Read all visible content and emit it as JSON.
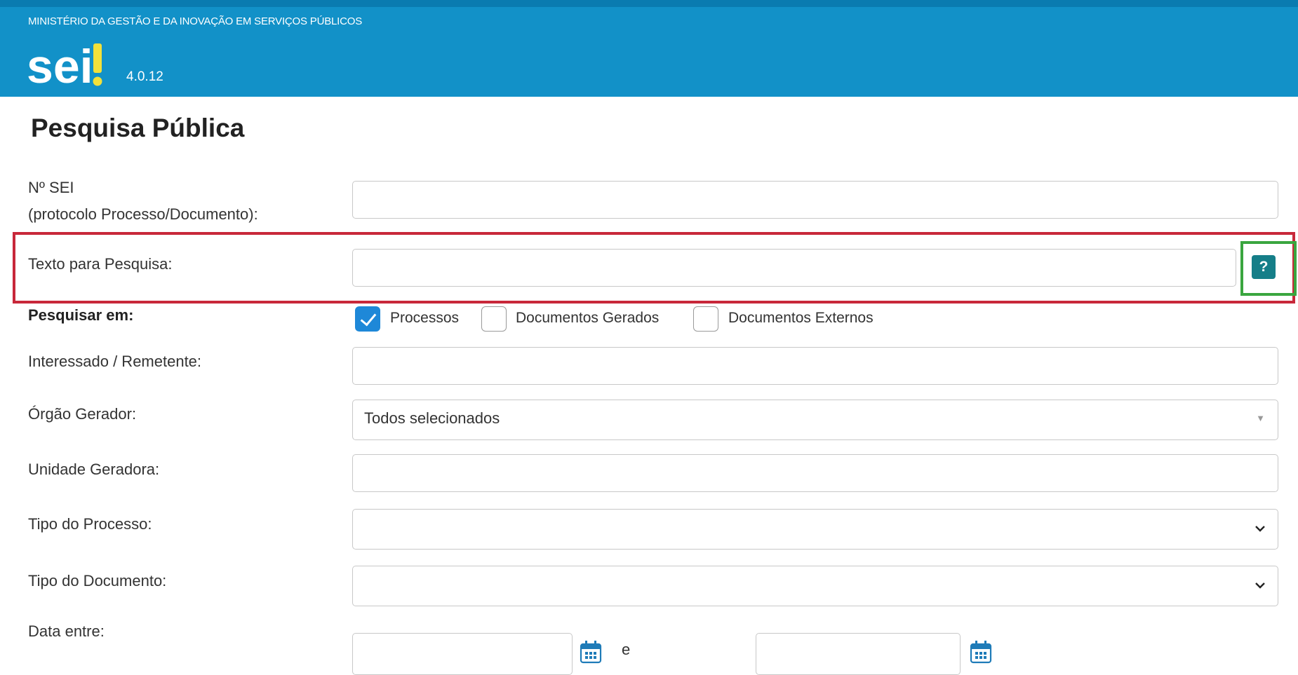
{
  "header": {
    "ministry": "MINISTÉRIO DA GESTÃO E DA INOVAÇÃO EM SERVIÇOS PÚBLICOS",
    "logo_text": "sei!",
    "version": "4.0.12"
  },
  "page_title": "Pesquisa Pública",
  "form": {
    "sei_number": {
      "label_line1": "Nº SEI",
      "label_line2": "(protocolo Processo/Documento):",
      "value": ""
    },
    "search_text": {
      "label": "Texto para Pesquisa:",
      "value": "",
      "help_label": "?"
    },
    "search_in": {
      "label": "Pesquisar em:",
      "options": [
        {
          "label": "Processos",
          "checked": true
        },
        {
          "label": "Documentos Gerados",
          "checked": false
        },
        {
          "label": "Documentos Externos",
          "checked": false
        }
      ]
    },
    "interested": {
      "label": "Interessado / Remetente:",
      "value": ""
    },
    "org": {
      "label": "Órgão Gerador:",
      "value": "Todos selecionados"
    },
    "unit": {
      "label": "Unidade Geradora:",
      "value": ""
    },
    "process_type": {
      "label": "Tipo do Processo:",
      "value": ""
    },
    "document_type": {
      "label": "Tipo do Documento:",
      "value": ""
    },
    "date_range": {
      "label": "Data entre:",
      "separator": "e",
      "from": "",
      "to": ""
    }
  },
  "colors": {
    "header_blue": "#1291c8",
    "help_button": "#157e88",
    "checkbox_checked": "#1e88d8",
    "highlight_red": "#c8283a",
    "highlight_green": "#3aa63f"
  },
  "icons": [
    "help-icon",
    "check-icon",
    "chevron-down-icon",
    "calendar-icon"
  ]
}
